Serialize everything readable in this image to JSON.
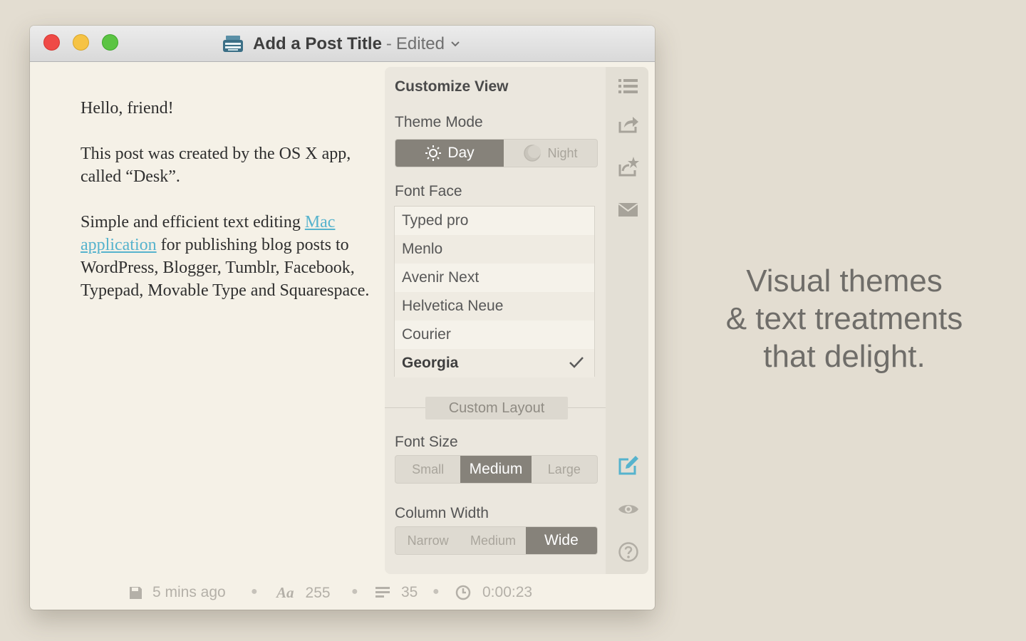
{
  "window": {
    "title": "Add a Post Title",
    "separator": "-",
    "state": "Edited"
  },
  "editor": {
    "paragraphs": [
      "Hello, friend!",
      "This post was created by the OS X app, called “Desk”."
    ],
    "p3_link": "Mac application",
    "p3_before": "Simple and efficient text editing",
    "p3_after": "for publishing blog posts to WordPress, Blogger, Tumblr, Facebook, Typepad, Movable Type and Squarespace."
  },
  "panel": {
    "heading": "Customize View",
    "theme_mode": {
      "label": "Theme Mode",
      "options": [
        "Day",
        "Night"
      ],
      "selected": "Day"
    },
    "font_face": {
      "label": "Font Face",
      "options": [
        "Typed pro",
        "Menlo",
        "Avenir Next",
        "Helvetica Neue",
        "Courier",
        "Georgia"
      ],
      "selected": "Georgia"
    },
    "custom_layout": "Custom Layout",
    "font_size": {
      "label": "Font Size",
      "options": [
        "Small",
        "Medium",
        "Large"
      ],
      "selected": "Medium"
    },
    "column_width": {
      "label": "Column Width",
      "options": [
        "Narrow",
        "Medium",
        "Wide"
      ],
      "selected": "Wide"
    }
  },
  "sidebar": {
    "icons": [
      "list-icon",
      "share-icon",
      "favorite-share-icon",
      "mail-icon",
      "edit-icon",
      "eye-icon",
      "help-icon"
    ],
    "active_color": "#56b3cd"
  },
  "status": {
    "saved": "5 mins ago",
    "chars": "255",
    "lines": "35",
    "time": "0:00:23",
    "font_glyph": "Aa"
  },
  "tagline": [
    "Visual themes",
    "& text treatments",
    "that delight."
  ]
}
